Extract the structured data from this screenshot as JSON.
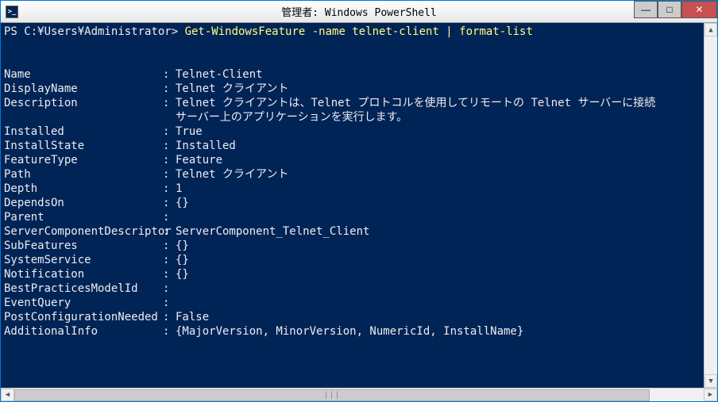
{
  "window": {
    "title": "管理者: Windows PowerShell",
    "icon_glyph": ">_"
  },
  "controls": {
    "minimize": "—",
    "maximize": "□",
    "close": "✕"
  },
  "prompt": "PS C:¥Users¥Administrator> ",
  "command": "Get-WindowsFeature -name telnet-client | format-list",
  "properties": [
    {
      "key": "Name",
      "value": "Telnet-Client"
    },
    {
      "key": "DisplayName",
      "value": "Telnet クライアント"
    },
    {
      "key": "Description",
      "value": "Telnet クライアントは、Telnet プロトコルを使用してリモートの Telnet サーバーに接続"
    },
    {
      "key": "",
      "value": "サーバー上のアプリケーションを実行します。"
    },
    {
      "key": "Installed",
      "value": "True"
    },
    {
      "key": "InstallState",
      "value": "Installed"
    },
    {
      "key": "FeatureType",
      "value": "Feature"
    },
    {
      "key": "Path",
      "value": "Telnet クライアント"
    },
    {
      "key": "Depth",
      "value": "1"
    },
    {
      "key": "DependsOn",
      "value": "{}"
    },
    {
      "key": "Parent",
      "value": ""
    },
    {
      "key": "ServerComponentDescriptor",
      "value": "ServerComponent_Telnet_Client"
    },
    {
      "key": "SubFeatures",
      "value": "{}"
    },
    {
      "key": "SystemService",
      "value": "{}"
    },
    {
      "key": "Notification",
      "value": "{}"
    },
    {
      "key": "BestPracticesModelId",
      "value": ""
    },
    {
      "key": "EventQuery",
      "value": ""
    },
    {
      "key": "PostConfigurationNeeded",
      "value": "False"
    },
    {
      "key": "AdditionalInfo",
      "value": "{MajorVersion, MinorVersion, NumericId, InstallName}"
    }
  ],
  "scroll": {
    "up": "▲",
    "down": "▼",
    "left": "◀",
    "right": "▶",
    "grip": "|||"
  }
}
